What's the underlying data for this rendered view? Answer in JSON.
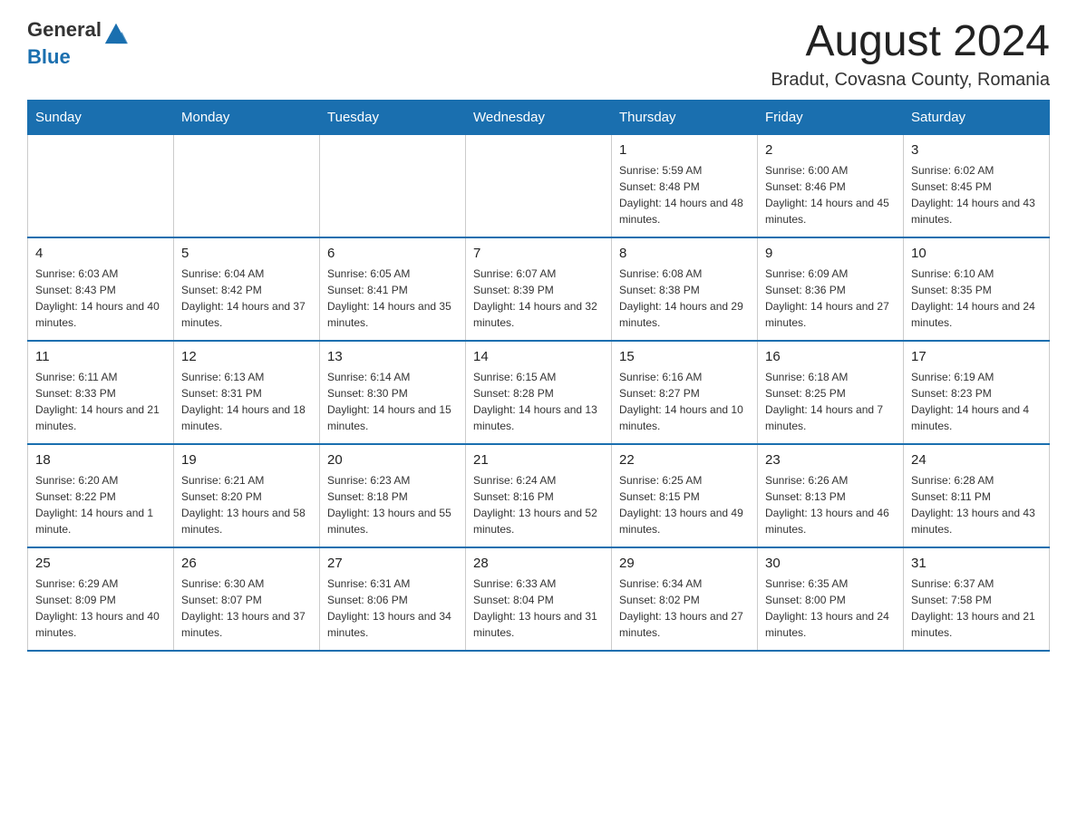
{
  "logo": {
    "general": "General",
    "blue": "Blue"
  },
  "title": "August 2024",
  "subtitle": "Bradut, Covasna County, Romania",
  "headers": [
    "Sunday",
    "Monday",
    "Tuesday",
    "Wednesday",
    "Thursday",
    "Friday",
    "Saturday"
  ],
  "weeks": [
    [
      {
        "day": "",
        "info": ""
      },
      {
        "day": "",
        "info": ""
      },
      {
        "day": "",
        "info": ""
      },
      {
        "day": "",
        "info": ""
      },
      {
        "day": "1",
        "info": "Sunrise: 5:59 AM\nSunset: 8:48 PM\nDaylight: 14 hours and 48 minutes."
      },
      {
        "day": "2",
        "info": "Sunrise: 6:00 AM\nSunset: 8:46 PM\nDaylight: 14 hours and 45 minutes."
      },
      {
        "day": "3",
        "info": "Sunrise: 6:02 AM\nSunset: 8:45 PM\nDaylight: 14 hours and 43 minutes."
      }
    ],
    [
      {
        "day": "4",
        "info": "Sunrise: 6:03 AM\nSunset: 8:43 PM\nDaylight: 14 hours and 40 minutes."
      },
      {
        "day": "5",
        "info": "Sunrise: 6:04 AM\nSunset: 8:42 PM\nDaylight: 14 hours and 37 minutes."
      },
      {
        "day": "6",
        "info": "Sunrise: 6:05 AM\nSunset: 8:41 PM\nDaylight: 14 hours and 35 minutes."
      },
      {
        "day": "7",
        "info": "Sunrise: 6:07 AM\nSunset: 8:39 PM\nDaylight: 14 hours and 32 minutes."
      },
      {
        "day": "8",
        "info": "Sunrise: 6:08 AM\nSunset: 8:38 PM\nDaylight: 14 hours and 29 minutes."
      },
      {
        "day": "9",
        "info": "Sunrise: 6:09 AM\nSunset: 8:36 PM\nDaylight: 14 hours and 27 minutes."
      },
      {
        "day": "10",
        "info": "Sunrise: 6:10 AM\nSunset: 8:35 PM\nDaylight: 14 hours and 24 minutes."
      }
    ],
    [
      {
        "day": "11",
        "info": "Sunrise: 6:11 AM\nSunset: 8:33 PM\nDaylight: 14 hours and 21 minutes."
      },
      {
        "day": "12",
        "info": "Sunrise: 6:13 AM\nSunset: 8:31 PM\nDaylight: 14 hours and 18 minutes."
      },
      {
        "day": "13",
        "info": "Sunrise: 6:14 AM\nSunset: 8:30 PM\nDaylight: 14 hours and 15 minutes."
      },
      {
        "day": "14",
        "info": "Sunrise: 6:15 AM\nSunset: 8:28 PM\nDaylight: 14 hours and 13 minutes."
      },
      {
        "day": "15",
        "info": "Sunrise: 6:16 AM\nSunset: 8:27 PM\nDaylight: 14 hours and 10 minutes."
      },
      {
        "day": "16",
        "info": "Sunrise: 6:18 AM\nSunset: 8:25 PM\nDaylight: 14 hours and 7 minutes."
      },
      {
        "day": "17",
        "info": "Sunrise: 6:19 AM\nSunset: 8:23 PM\nDaylight: 14 hours and 4 minutes."
      }
    ],
    [
      {
        "day": "18",
        "info": "Sunrise: 6:20 AM\nSunset: 8:22 PM\nDaylight: 14 hours and 1 minute."
      },
      {
        "day": "19",
        "info": "Sunrise: 6:21 AM\nSunset: 8:20 PM\nDaylight: 13 hours and 58 minutes."
      },
      {
        "day": "20",
        "info": "Sunrise: 6:23 AM\nSunset: 8:18 PM\nDaylight: 13 hours and 55 minutes."
      },
      {
        "day": "21",
        "info": "Sunrise: 6:24 AM\nSunset: 8:16 PM\nDaylight: 13 hours and 52 minutes."
      },
      {
        "day": "22",
        "info": "Sunrise: 6:25 AM\nSunset: 8:15 PM\nDaylight: 13 hours and 49 minutes."
      },
      {
        "day": "23",
        "info": "Sunrise: 6:26 AM\nSunset: 8:13 PM\nDaylight: 13 hours and 46 minutes."
      },
      {
        "day": "24",
        "info": "Sunrise: 6:28 AM\nSunset: 8:11 PM\nDaylight: 13 hours and 43 minutes."
      }
    ],
    [
      {
        "day": "25",
        "info": "Sunrise: 6:29 AM\nSunset: 8:09 PM\nDaylight: 13 hours and 40 minutes."
      },
      {
        "day": "26",
        "info": "Sunrise: 6:30 AM\nSunset: 8:07 PM\nDaylight: 13 hours and 37 minutes."
      },
      {
        "day": "27",
        "info": "Sunrise: 6:31 AM\nSunset: 8:06 PM\nDaylight: 13 hours and 34 minutes."
      },
      {
        "day": "28",
        "info": "Sunrise: 6:33 AM\nSunset: 8:04 PM\nDaylight: 13 hours and 31 minutes."
      },
      {
        "day": "29",
        "info": "Sunrise: 6:34 AM\nSunset: 8:02 PM\nDaylight: 13 hours and 27 minutes."
      },
      {
        "day": "30",
        "info": "Sunrise: 6:35 AM\nSunset: 8:00 PM\nDaylight: 13 hours and 24 minutes."
      },
      {
        "day": "31",
        "info": "Sunrise: 6:37 AM\nSunset: 7:58 PM\nDaylight: 13 hours and 21 minutes."
      }
    ]
  ]
}
